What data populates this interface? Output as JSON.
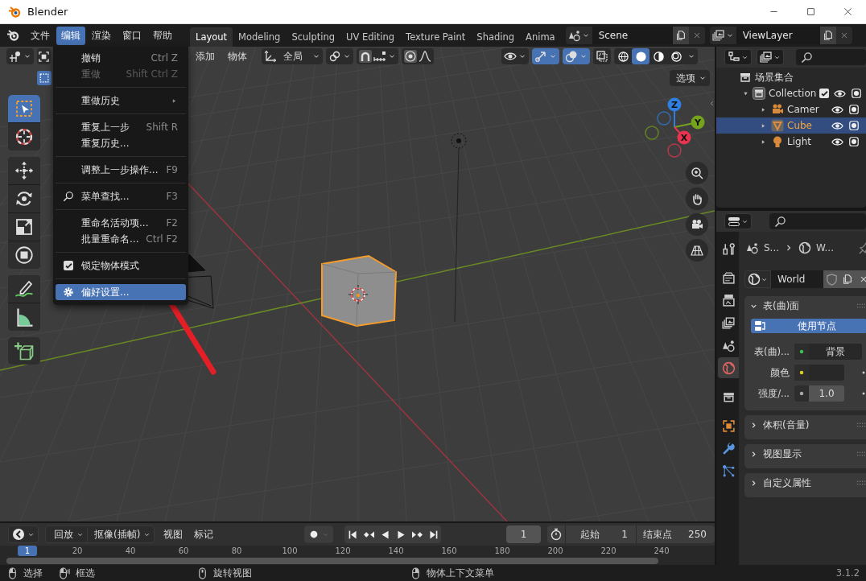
{
  "window": {
    "title": "Blender"
  },
  "menubar": [
    {
      "label": "文件",
      "selected": false
    },
    {
      "label": "编辑",
      "selected": true
    },
    {
      "label": "渲染",
      "selected": false
    },
    {
      "label": "窗口",
      "selected": false
    },
    {
      "label": "帮助",
      "selected": false
    }
  ],
  "workspaces": [
    {
      "label": "Layout",
      "selected": true
    },
    {
      "label": "Modeling",
      "selected": false
    },
    {
      "label": "Sculpting",
      "selected": false
    },
    {
      "label": "UV Editing",
      "selected": false
    },
    {
      "label": "Texture Paint",
      "selected": false
    },
    {
      "label": "Shading",
      "selected": false
    },
    {
      "label": "Anima",
      "selected": false
    }
  ],
  "scene": {
    "name": "Scene"
  },
  "view_layer": {
    "name": "ViewLayer"
  },
  "viewport": {
    "menus": [
      "添加",
      "物体"
    ],
    "transform_orientation": "全局",
    "options": "选项",
    "select_box_mode": {
      "on": true
    },
    "toggles": [
      {
        "kind": "gizmos",
        "on": true
      },
      {
        "kind": "overlays",
        "on": true
      },
      {
        "kind": "xray",
        "on": false
      }
    ],
    "shading": [
      {
        "kind": "wireframe",
        "selected": false
      },
      {
        "kind": "solid",
        "selected": true
      },
      {
        "kind": "material",
        "selected": false
      },
      {
        "kind": "rendered",
        "selected": false
      }
    ],
    "gizmo_axes": [
      {
        "label": "Z",
        "color": "#2f7fe0"
      },
      {
        "label": "Y",
        "color": "#74a31c"
      },
      {
        "label": "X",
        "color": "#e8344f"
      }
    ]
  },
  "toolbar": [
    {
      "kind": "select",
      "selected": true
    },
    {
      "kind": "cursor",
      "selected": false
    },
    {
      "kind": "move",
      "selected": false
    },
    {
      "kind": "rotate",
      "selected": false
    },
    {
      "kind": "scale",
      "selected": false
    },
    {
      "kind": "transform",
      "selected": false
    },
    {
      "kind": "annotate",
      "selected": false
    },
    {
      "kind": "measure",
      "selected": false
    },
    {
      "kind": "add_cube",
      "selected": false
    }
  ],
  "edit_menu": [
    {
      "kind": "item",
      "label": "撤销",
      "shortcut": "Ctrl Z",
      "disabled": false,
      "selected": false
    },
    {
      "kind": "item",
      "label": "重做",
      "shortcut": "Shift Ctrl Z",
      "disabled": true,
      "selected": false
    },
    {
      "kind": "separator"
    },
    {
      "kind": "submenu",
      "label": "重做历史",
      "disabled": false,
      "selected": false
    },
    {
      "kind": "separator"
    },
    {
      "kind": "item",
      "label": "重复上一步",
      "shortcut": "Shift R",
      "disabled": false,
      "selected": false
    },
    {
      "kind": "item",
      "label": "重复历史...",
      "disabled": false,
      "selected": false
    },
    {
      "kind": "separator"
    },
    {
      "kind": "item",
      "label": "调整上一步操作...",
      "shortcut": "F9",
      "disabled": false,
      "selected": false
    },
    {
      "kind": "separator"
    },
    {
      "kind": "search",
      "label": "菜单查找...",
      "shortcut": "F3",
      "disabled": false,
      "selected": false
    },
    {
      "kind": "separator"
    },
    {
      "kind": "item",
      "label": "重命名活动项...",
      "shortcut": "F2",
      "disabled": false,
      "selected": false
    },
    {
      "kind": "item",
      "label": "批量重命名...",
      "shortcut": "Ctrl F2",
      "disabled": false,
      "selected": false
    },
    {
      "kind": "separator"
    },
    {
      "kind": "checkbox",
      "label": "锁定物体模式",
      "checked": true,
      "disabled": false,
      "selected": false
    },
    {
      "kind": "separator"
    },
    {
      "kind": "settings",
      "label": "偏好设置...",
      "disabled": false,
      "selected": true
    }
  ],
  "outliner": {
    "tree": [
      {
        "kind": "scene_collection",
        "label": "场景集合",
        "children": [
          {
            "kind": "collection",
            "label": "Collection",
            "expanded": true,
            "checked": true,
            "selected": false,
            "children": [
              {
                "kind": "camera",
                "label": "Camer",
                "expanded": false,
                "selected": false
              },
              {
                "kind": "mesh",
                "label": "Cube",
                "expanded": false,
                "selected": true
              },
              {
                "kind": "light",
                "label": "Light",
                "expanded": false,
                "selected": false
              }
            ]
          }
        ]
      }
    ]
  },
  "properties": {
    "tabs": [
      {
        "kind": "tool",
        "selected": false
      },
      {
        "kind": "render",
        "selected": false
      },
      {
        "kind": "output",
        "selected": false
      },
      {
        "kind": "view_layer",
        "selected": false
      },
      {
        "kind": "scene",
        "selected": false
      },
      {
        "kind": "world",
        "selected": true
      },
      {
        "kind": "collection",
        "selected": false
      },
      {
        "kind": "object",
        "selected": false
      },
      {
        "kind": "modifier",
        "selected": false
      },
      {
        "kind": "particles",
        "selected": false
      }
    ],
    "breadcrumb": [
      "S...",
      "W..."
    ],
    "world": "World",
    "panels": [
      {
        "title": "表(曲)面",
        "expanded": true,
        "button": "使用节点",
        "fields": [
          {
            "kind": "link",
            "label": "表(曲)...",
            "value": "背景",
            "color": "#3fbf4f"
          },
          {
            "kind": "color",
            "label": "颜色",
            "color": "#d8d020"
          },
          {
            "kind": "number",
            "label": "强度/...",
            "value": "1.0",
            "color": "#a8a8a8"
          }
        ]
      },
      {
        "title": "体积(音量)",
        "expanded": false
      },
      {
        "title": "视图显示",
        "expanded": false
      },
      {
        "title": "自定义属性",
        "expanded": false
      }
    ]
  },
  "timeline": {
    "menus": [
      "回放",
      "抠像(插帧)",
      "视图",
      "标记"
    ],
    "current_frame": "1",
    "start_label": "起始",
    "start": "1",
    "end_label": "结束点",
    "end": "250",
    "playhead": "1",
    "ruler": [
      "20",
      "40",
      "60",
      "80",
      "100",
      "120",
      "140",
      "160",
      "180",
      "200",
      "220",
      "240"
    ]
  },
  "status_bar": {
    "hints": [
      "选择",
      "框选",
      "旋转视图",
      "物体上下文菜单"
    ],
    "version": "3.1.2"
  }
}
